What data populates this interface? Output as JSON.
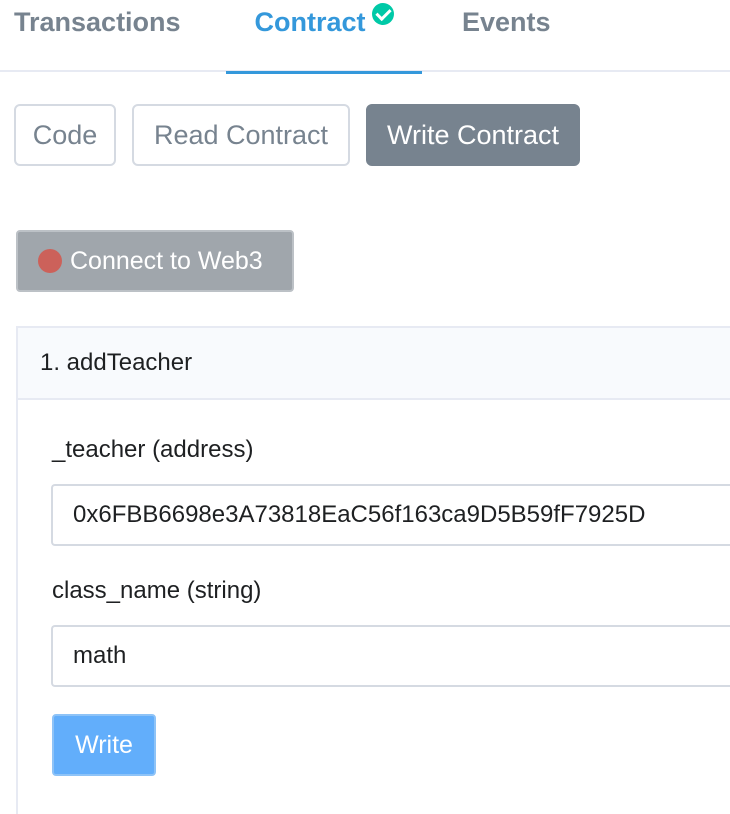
{
  "tabs": {
    "transactions": "Transactions",
    "contract": "Contract",
    "events": "Events"
  },
  "sub_tabs": {
    "code": "Code",
    "read_contract": "Read Contract",
    "write_contract": "Write Contract"
  },
  "connect": {
    "label": "Connect to Web3"
  },
  "function_card": {
    "title": "1. addTeacher",
    "fields": [
      {
        "label": "_teacher (address)",
        "value": "0x6FBB6698e3A73818EaC56f163ca9D5B59fF7925D"
      },
      {
        "label": "class_name (string)",
        "value": "math"
      }
    ],
    "write_label": "Write"
  },
  "colors": {
    "accent": "#3498db",
    "verified": "#00c9a7",
    "active_subtab": "#77838f",
    "write_button": "#62aefb",
    "disconnected_dot": "#de4437"
  }
}
